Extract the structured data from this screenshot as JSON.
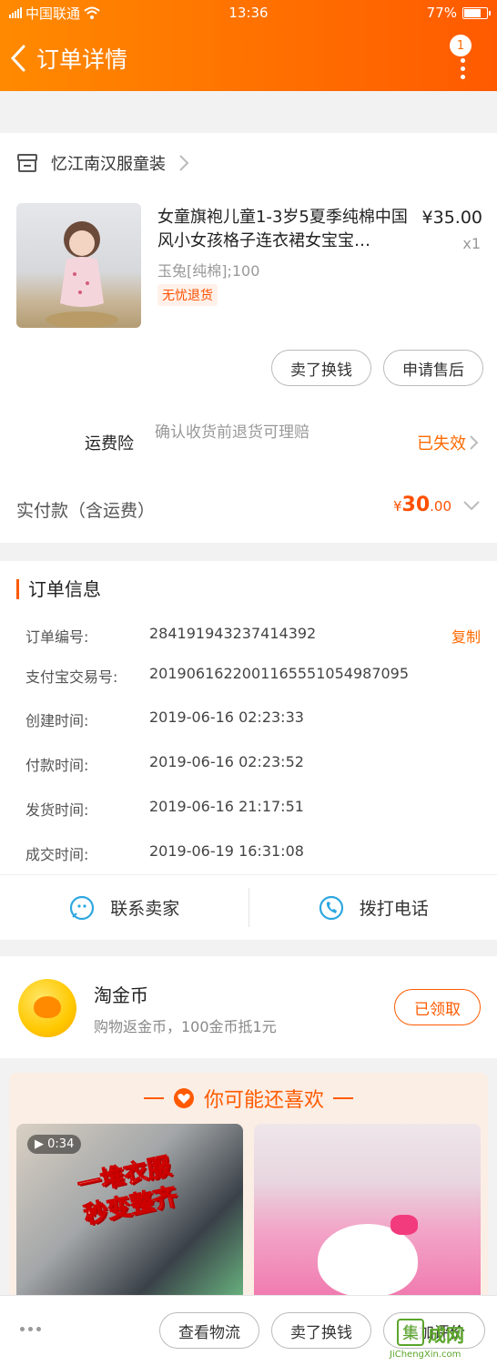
{
  "status_bar": {
    "carrier": "中国联通",
    "time": "13:36",
    "battery": "77%",
    "battery_level": 0.77
  },
  "nav": {
    "title": "订单详情",
    "badge": "1"
  },
  "shop": {
    "name": "忆江南汉服童装"
  },
  "product": {
    "title": "女童旗袍儿童1-3岁5夏季纯棉中国风小女孩格子连衣裙女宝宝…",
    "price": "¥35.00",
    "qty": "x1",
    "sku": "玉兔[纯棉];100",
    "tag": "无忧退货"
  },
  "item_actions": {
    "sell": "卖了换钱",
    "aftersale": "申请售后"
  },
  "insurance": {
    "label": "运费险",
    "desc": "确认收货前退货可理赔",
    "status": "已失效"
  },
  "payment": {
    "label": "实付款（含运费）",
    "currency": "¥",
    "amount_int": "30",
    "amount_dec": ".00"
  },
  "order_info": {
    "title": "订单信息",
    "copy_label": "复制",
    "rows": [
      {
        "label": "订单编号:",
        "value": "284191943237414392"
      },
      {
        "label": "支付宝交易号:",
        "value": "2019061622001165551054987095"
      },
      {
        "label": "创建时间:",
        "value": "2019-06-16 02:23:33"
      },
      {
        "label": "付款时间:",
        "value": "2019-06-16 02:23:52"
      },
      {
        "label": "发货时间:",
        "value": "2019-06-16 21:17:51"
      },
      {
        "label": "成交时间:",
        "value": "2019-06-19 16:31:08"
      }
    ]
  },
  "contact": {
    "seller": "联系卖家",
    "phone": "拨打电话"
  },
  "coins": {
    "title": "淘金币",
    "subtitle": "购物返金币，100金币抵1元",
    "button": "已领取"
  },
  "recommend": {
    "title": "你可能还喜欢",
    "card1": {
      "duration": "0:34",
      "overlay_line1": "一堆衣服",
      "overlay_line2": "秒变整齐"
    }
  },
  "bottom_bar": {
    "logistics": "查看物流",
    "sell": "卖了换钱",
    "review": "追加评价"
  },
  "watermark": {
    "char": "集",
    "text": "成网",
    "url": "JiChengXin.com"
  },
  "colors": {
    "accent": "#ff5a00",
    "header_start": "#ff8a00",
    "header_end": "#ff5a00"
  }
}
